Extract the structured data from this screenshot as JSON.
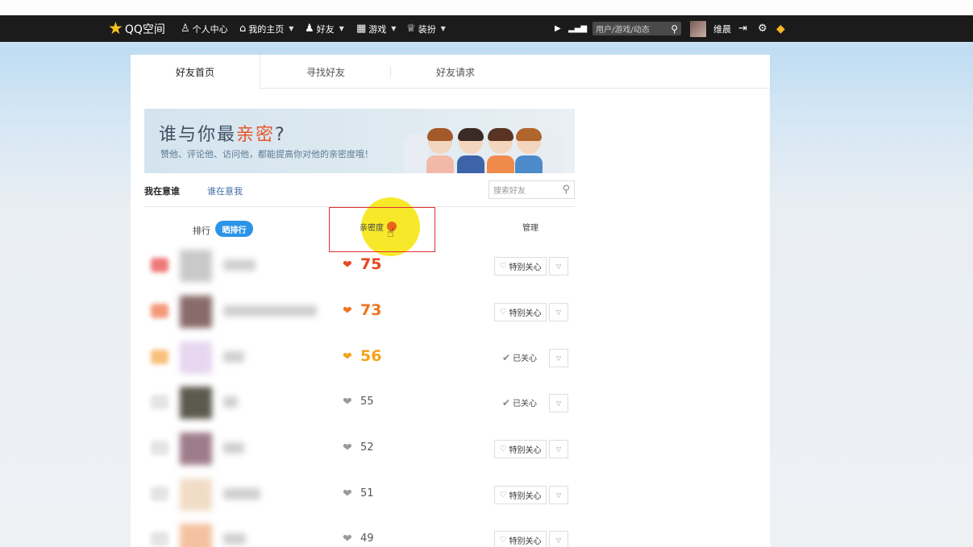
{
  "navbar": {
    "logo_text": "QQ空间",
    "items": [
      {
        "label": "个人中心",
        "icon": "person-icon",
        "glyph": "♙"
      },
      {
        "label": "我的主页",
        "icon": "home-icon",
        "glyph": "⌂"
      },
      {
        "label": "好友",
        "icon": "friends-icon",
        "glyph": "♟"
      },
      {
        "label": "游戏",
        "icon": "grid-icon",
        "glyph": "▦"
      },
      {
        "label": "装扮",
        "icon": "shirt-icon",
        "glyph": "♕"
      }
    ],
    "search_placeholder": "用户/游戏/动态",
    "username": "维晨"
  },
  "tabs": [
    "好友首页",
    "寻找好友",
    "好友请求"
  ],
  "banner": {
    "title_start": "谁与你最",
    "title_accent": "亲密",
    "title_end": "?",
    "subtitle": "赞他、评论他、访问他，都能提高你对他的亲密度哦！"
  },
  "subtabs": {
    "active": "我在意谁",
    "other": "谁在意我"
  },
  "friend_search_placeholder": "搜索好友",
  "table_header": {
    "rank": "排行",
    "rank_button": "晒排行",
    "intimacy": "亲密度",
    "manage": "管理"
  },
  "colors": {
    "top1": "#e8461f",
    "top2": "#ee7320",
    "top3": "#f4a21b",
    "grey": "#999999",
    "accent_blue": "#2b94e8"
  },
  "rows": [
    {
      "score": "75",
      "action": "特别关心",
      "cared": false
    },
    {
      "score": "73",
      "action": "特别关心",
      "cared": false
    },
    {
      "score": "56",
      "action": "已关心",
      "cared": true
    },
    {
      "score": "55",
      "action": "已关心",
      "cared": true
    },
    {
      "score": "52",
      "action": "特别关心",
      "cared": false
    },
    {
      "score": "51",
      "action": "特别关心",
      "cared": false
    },
    {
      "score": "49",
      "action": "特别关心",
      "cared": false
    }
  ]
}
